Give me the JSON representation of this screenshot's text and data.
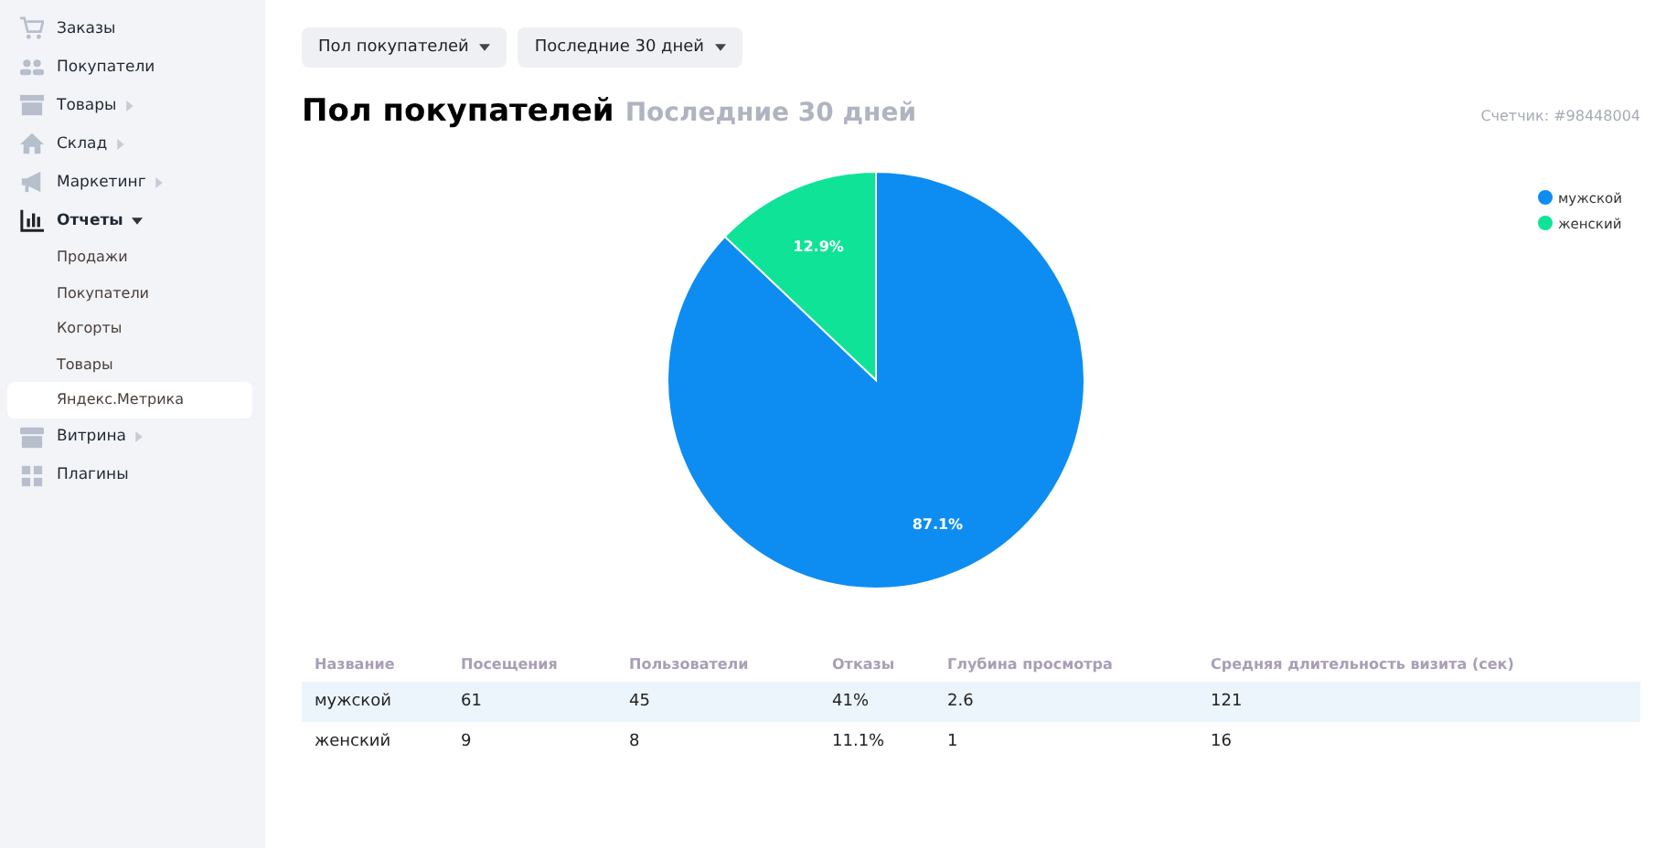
{
  "sidebar": {
    "items": [
      {
        "label": "Заказы",
        "has_submenu": false,
        "expanded": false
      },
      {
        "label": "Покупатели",
        "has_submenu": false,
        "expanded": false
      },
      {
        "label": "Товары",
        "has_submenu": true,
        "expanded": false
      },
      {
        "label": "Склад",
        "has_submenu": true,
        "expanded": false
      },
      {
        "label": "Маркетинг",
        "has_submenu": true,
        "expanded": false
      },
      {
        "label": "Отчеты",
        "has_submenu": true,
        "expanded": true,
        "children": [
          {
            "label": "Продажи",
            "selected": false
          },
          {
            "label": "Покупатели",
            "selected": false
          },
          {
            "label": "Когорты",
            "selected": false
          },
          {
            "label": "Товары",
            "selected": false
          },
          {
            "label": "Яндекс.Метрика",
            "selected": true
          }
        ]
      },
      {
        "label": "Витрина",
        "has_submenu": true,
        "expanded": false
      },
      {
        "label": "Плагины",
        "has_submenu": false,
        "expanded": false
      }
    ]
  },
  "filters": [
    {
      "label": "Пол покупателей"
    },
    {
      "label": "Последние 30 дней"
    }
  ],
  "heading": {
    "title": "Пол покупателей",
    "subtitle": "Последние 30 дней"
  },
  "counter": "Счетчик: #98448004",
  "chart_data": {
    "type": "pie",
    "categories": [
      "мужской",
      "женский"
    ],
    "values": [
      87.1,
      12.9
    ],
    "colors": [
      "#0d8df2",
      "#0fe397"
    ],
    "data_labels": true,
    "value_labels": [
      "87.1%",
      "12.9%"
    ],
    "legend": "right"
  },
  "table": {
    "columns": [
      "Название",
      "Посещения",
      "Пользователи",
      "Отказы",
      "Глубина просмотра",
      "Средняя длительность визита (сек)"
    ],
    "rows": [
      {
        "cells": [
          "мужской",
          "61",
          "45",
          "41%",
          "2.6",
          "121"
        ],
        "highlighted": true
      },
      {
        "cells": [
          "женский",
          "9",
          "8",
          "11.1%",
          "1",
          "16"
        ],
        "highlighted": false
      }
    ]
  }
}
